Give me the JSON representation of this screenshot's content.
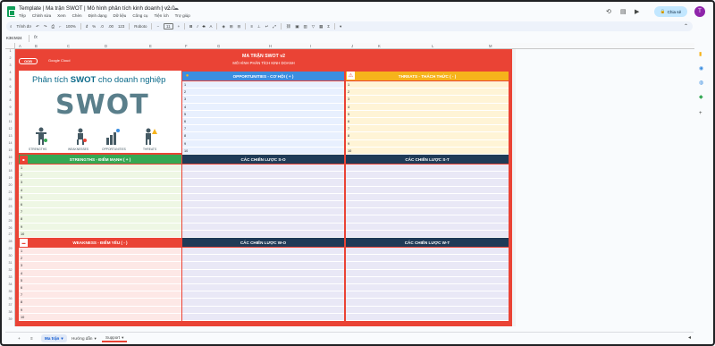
{
  "app": {
    "doc_title": "Template | Ma trận SWOT | Mô hình phân tích kinh doanh | v2.0",
    "menu": [
      "Tệp",
      "Chỉnh sửa",
      "Xem",
      "Chèn",
      "Định dạng",
      "Dữ liệu",
      "Công cụ",
      "Tiện ích",
      "Trợ giúp"
    ],
    "share_label": "Chia sẻ",
    "avatar_initial": "T"
  },
  "toolbar": {
    "search": "Trình đơ",
    "zoom": "100%",
    "currency": "đ",
    "percent": "%",
    "dec_less": ".0",
    "dec_more": ".00",
    "number_format": "123",
    "font": "Roboto",
    "font_size": "11"
  },
  "formula_bar": {
    "name_box": "K36:M24",
    "fx": "fx"
  },
  "columns": [
    "A",
    "B",
    "C",
    "D",
    "E",
    "F",
    "G",
    "H",
    "I",
    "J",
    "K",
    "L",
    "M"
  ],
  "rows": [
    "1",
    "2",
    "3",
    "4",
    "5",
    "6",
    "7",
    "8",
    "9",
    "10",
    "11",
    "12",
    "13",
    "14",
    "15",
    "16",
    "17",
    "18",
    "19",
    "20",
    "21",
    "22",
    "23",
    "24",
    "25",
    "26",
    "27",
    "28",
    "29",
    "30",
    "31",
    "32",
    "33",
    "34",
    "35",
    "36",
    "37",
    "38",
    "39"
  ],
  "sheet": {
    "title": "MA TRẬN SWOT v2",
    "subtitle": "MÔ HÌNH PHÂN TÍCH KINH DOANH",
    "brand_a": "OOB",
    "brand_b": "Google Cloud",
    "swot_heading_prefix": "Phân tích ",
    "swot_heading_bold": "SWOT",
    "swot_heading_suffix": " cho doanh nghiệp",
    "swot_big": "SWOT",
    "figure_labels": [
      "STRENGTHS",
      "WEAKNESSES",
      "OPPORTUNITIES",
      "THREATS"
    ],
    "opportunities_header": "OPPORTUNITIES - CƠ HỘI ( + )",
    "threats_header": "THREATS - THÁCH THỨC ( - )",
    "strengths_header": "STRENGTHS - ĐIỂM MẠNH ( + )",
    "weakness_header": "WEAKNESS - ĐIỂM YẾU ( - )",
    "so_header": "CÁC CHIẾN LƯỢC S-O",
    "st_header": "CÁC CHIẾN LƯỢC S-T",
    "wo_header": "CÁC CHIẾN LƯỢC W-O",
    "wt_header": "CÁC CHIẾN LƯỢC W-T",
    "numbers": [
      "1",
      "2",
      "3",
      "4",
      "5",
      "6",
      "7",
      "8",
      "9",
      "10"
    ]
  },
  "tabs": [
    {
      "label": "Ma trận",
      "active": true
    },
    {
      "label": "Hướng dẫn",
      "active": false
    },
    {
      "label": "Support",
      "active": false
    }
  ],
  "colors": {
    "red": "#ea4335",
    "blue": "#3c8ee0",
    "yellow": "#f6b31b",
    "green": "#34a853",
    "navy": "#1f3b57"
  }
}
